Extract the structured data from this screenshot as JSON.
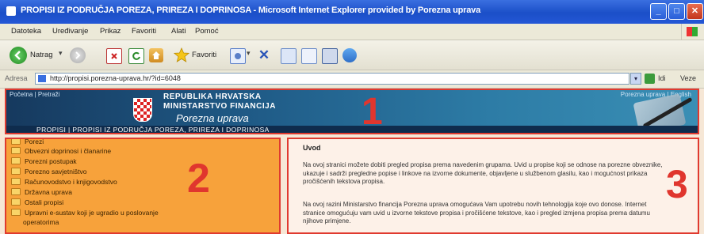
{
  "window": {
    "title": "PROPISI IZ PODRUČJA POREZA, PRIREZA I DOPRINOSA - Microsoft Internet Explorer provided by Porezna uprava",
    "minimize_label": "_",
    "maximize_label": "□",
    "close_label": "✕"
  },
  "menubar": {
    "items": [
      "Datoteka",
      "Uređivanje",
      "Prikaz",
      "Favoriti",
      "Alati",
      "Pomoć"
    ]
  },
  "toolbar": {
    "back_label": "Natrag",
    "favorites_label": "Favoriti",
    "icons": [
      "back-icon",
      "forward-icon",
      "stop-icon",
      "refresh-icon",
      "home-icon",
      "favorites-star-icon",
      "media-icon",
      "history-icon",
      "mail-icon",
      "print-icon",
      "edit-icon",
      "discuss-icon",
      "messenger-icon"
    ]
  },
  "addressbar": {
    "label": "Adresa",
    "url": "http://propisi.porezna-uprava.hr/?id=6048",
    "go_label": "Idi",
    "links_label": "Veze"
  },
  "page": {
    "banner": {
      "top_nav": "Početna  |  Pretraži",
      "right_nav": "Porezna uprava  |  English",
      "republic": "REPUBLIKA HRVATSKA",
      "ministry": "MINISTARSTVO FINANCIJA",
      "agency": "Porezna uprava",
      "section_title": "PROPISI  |  PROPISI IZ PODRUČJA POREZA, PRIREZA I DOPRINOSA"
    },
    "nav_items": [
      "Porezi",
      "Obvezni doprinosi i članarine",
      "Porezni postupak",
      "Porezno savjetništvo",
      "Računovodstvo i knjigovodstvo",
      "Državna uprava",
      "Ostali propisi",
      "Upravni e-sustav koji je ugradio u poslovanje",
      "operatorima"
    ],
    "content": {
      "heading": "Uvod",
      "paragraph1": "Na ovoj stranici možete dobiti pregled propisa prema navedenim grupama. Uvid u propise koji se odnose na porezne obveznike, ukazuje i sadrži pregledne popise i linkove na izvorne dokumente, objavljene u službenom glasilu, kao i mogućnost prikaza pročišćenih tekstova propisa.",
      "paragraph2": "Na ovoj razini Ministarstvo financija Porezna uprava omogućava Vam upotrebu novih tehnologija koje ovo donose. Internet stranice omogućuju vam uvid u izvorne tekstove propisa i pročišćene tekstove, kao i pregled izmjena propisa prema datumu njihove primjene."
    },
    "annotations": {
      "region1": "1",
      "region2": "2",
      "region3": "3"
    }
  },
  "colors": {
    "annotation_red": "#e03a2f",
    "nav_orange": "#f7a23b",
    "banner_blue": "#1f5a86",
    "titlebar_blue": "#1b4fc8"
  }
}
